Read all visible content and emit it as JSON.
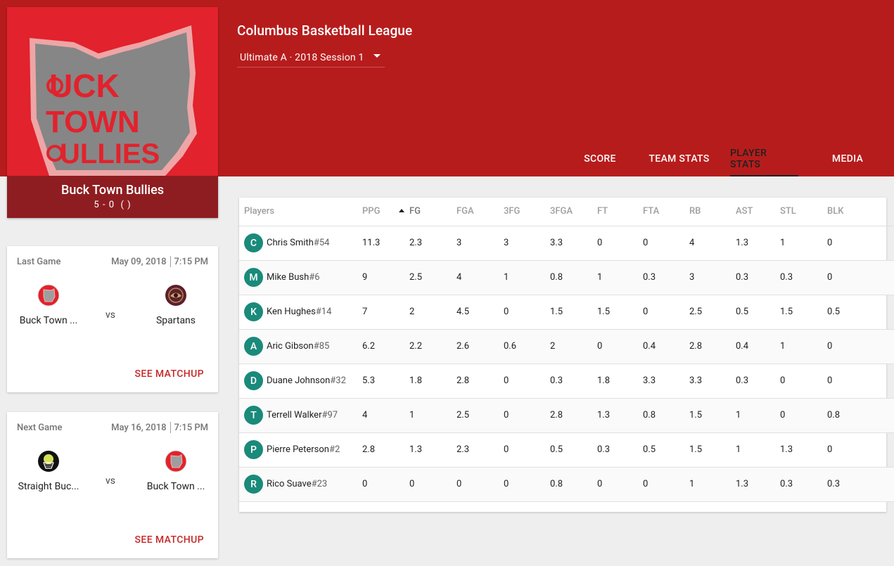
{
  "league": {
    "title": "Columbus Basketball League",
    "session": "Ultimate A · 2018 Session 1"
  },
  "tabs": [
    {
      "label": "SCORE",
      "active": false
    },
    {
      "label": "TEAM STATS",
      "active": false
    },
    {
      "label": "PLAYER STATS",
      "active": true
    },
    {
      "label": "MEDIA",
      "active": false
    }
  ],
  "team": {
    "name": "Buck Town Bullies",
    "record": "5 - 0",
    "record_extra": "( )",
    "logo_text": "UCK TOWN ULLIES"
  },
  "last_game": {
    "label": "Last Game",
    "date": "May 09, 2018",
    "time": "7:15 PM",
    "left_team": "Buck Town ...",
    "right_team": "Spartans",
    "vs": "vs",
    "action": "SEE MATCHUP"
  },
  "next_game": {
    "label": "Next Game",
    "date": "May 16, 2018",
    "time": "7:15 PM",
    "left_team": "Straight Buc...",
    "right_team": "Buck Town ...",
    "vs": "vs",
    "action": "SEE MATCHUP"
  },
  "table": {
    "columns": [
      "Players",
      "PPG",
      "FG",
      "FGA",
      "3FG",
      "3FGA",
      "FT",
      "FTA",
      "RB",
      "AST",
      "STL",
      "BLK"
    ],
    "sorted_column": "FG",
    "rows": [
      {
        "initial": "C",
        "name": "Chris Smith",
        "number": "#54",
        "stats": [
          "11.3",
          "2.3",
          "3",
          "3",
          "3.3",
          "0",
          "0",
          "4",
          "1.3",
          "1",
          "0"
        ]
      },
      {
        "initial": "M",
        "name": "Mike Bush",
        "number": "#6",
        "stats": [
          "9",
          "2.5",
          "4",
          "1",
          "0.8",
          "1",
          "0.3",
          "3",
          "0.3",
          "0.3",
          "0"
        ]
      },
      {
        "initial": "K",
        "name": "Ken Hughes",
        "number": "#14",
        "stats": [
          "7",
          "2",
          "4.5",
          "0",
          "1.5",
          "1.5",
          "0",
          "2.5",
          "0.5",
          "1.5",
          "0.5"
        ]
      },
      {
        "initial": "A",
        "name": "Aric Gibson",
        "number": "#85",
        "stats": [
          "6.2",
          "2.2",
          "2.6",
          "0.6",
          "2",
          "0",
          "0.4",
          "2.8",
          "0.4",
          "1",
          "0"
        ]
      },
      {
        "initial": "D",
        "name": "Duane Johnson",
        "number": "#32",
        "stats": [
          "5.3",
          "1.8",
          "2.8",
          "0",
          "0.3",
          "1.8",
          "3.3",
          "3.3",
          "0.3",
          "0",
          "0"
        ]
      },
      {
        "initial": "T",
        "name": "Terrell Walker",
        "number": "#97",
        "stats": [
          "4",
          "1",
          "2.5",
          "0",
          "2.8",
          "1.3",
          "0.8",
          "1.5",
          "1",
          "0",
          "0.8"
        ]
      },
      {
        "initial": "P",
        "name": "Pierre Peterson",
        "number": "#2",
        "stats": [
          "2.8",
          "1.3",
          "2.3",
          "0",
          "0.5",
          "0.3",
          "0.5",
          "1.5",
          "1",
          "1.3",
          "0"
        ]
      },
      {
        "initial": "R",
        "name": "Rico Suave",
        "number": "#23",
        "stats": [
          "0",
          "0",
          "0",
          "0",
          "0.8",
          "0",
          "0",
          "1",
          "1.3",
          "0.3",
          "0.3"
        ]
      }
    ]
  },
  "colors": {
    "header_red": "#b71c1c",
    "team_card_red": "#e2222c",
    "team_footer": "#8e1d21",
    "avatar_teal": "#1a8a7a",
    "matchup_link": "#c62828"
  }
}
